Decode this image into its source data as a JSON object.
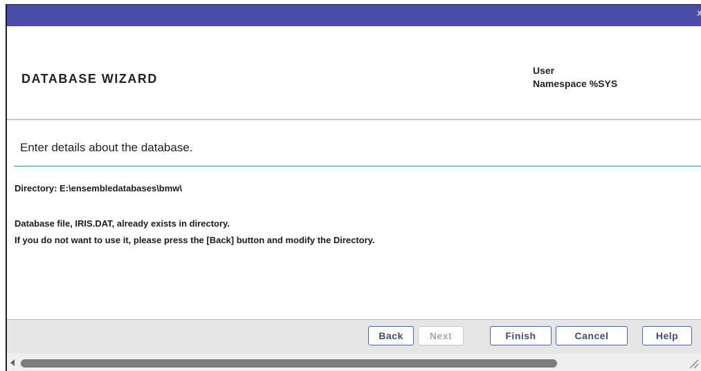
{
  "window": {
    "close_glyph": "x"
  },
  "header": {
    "title": "DATABASE WIZARD",
    "user_label": "User",
    "namespace_label": "Namespace %SYS"
  },
  "main": {
    "instruction": "Enter details about the database.",
    "directory": "Directory: E:\\ensembledatabases\\bmw\\",
    "message_line1": "Database file, IRIS.DAT, already exists in directory.",
    "message_line2": "If you do not want to use it, please press the [Back] button and modify the Directory."
  },
  "footer": {
    "buttons": {
      "back": "Back",
      "next": "Next",
      "finish": "Finish",
      "cancel": "Cancel",
      "help": "Help"
    },
    "next_disabled": true
  },
  "colors": {
    "titlebar": "#4b4ba8",
    "accent_rule": "#2b8c7c",
    "button_border": "#4b62a8"
  }
}
